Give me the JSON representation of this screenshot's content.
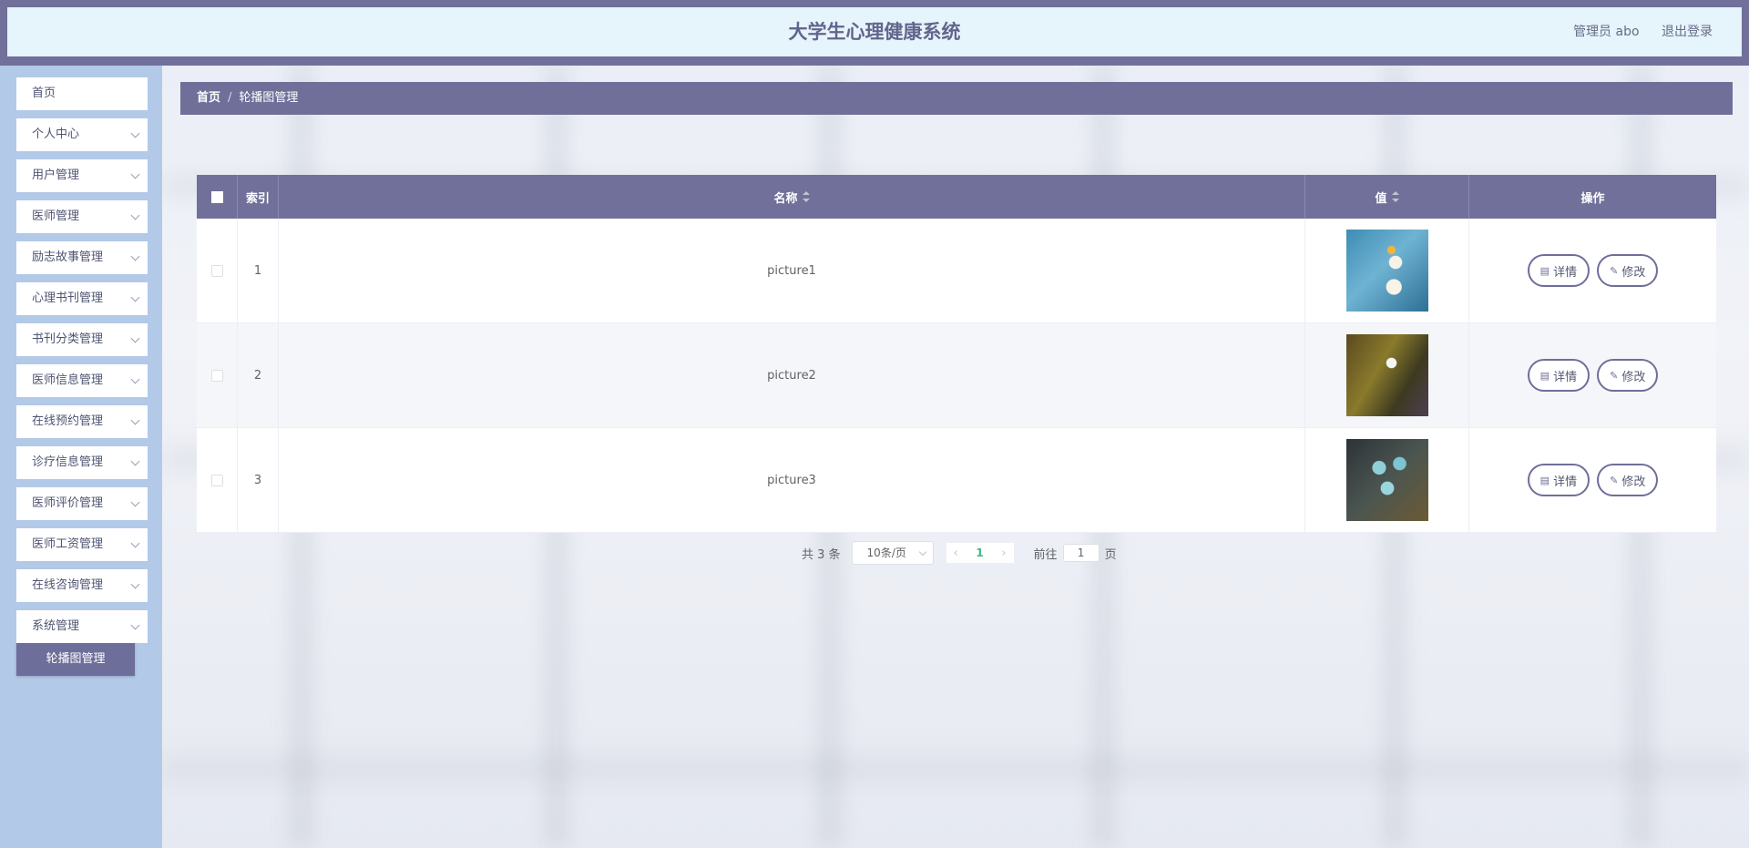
{
  "header": {
    "title": "大学生心理健康系统",
    "user_label": "管理员 abo",
    "logout_label": "退出登录"
  },
  "sidebar": {
    "items": [
      {
        "label": "首页",
        "has_arrow": false
      },
      {
        "label": "个人中心",
        "has_arrow": true
      },
      {
        "label": "用户管理",
        "has_arrow": true
      },
      {
        "label": "医师管理",
        "has_arrow": true
      },
      {
        "label": "励志故事管理",
        "has_arrow": true
      },
      {
        "label": "心理书刊管理",
        "has_arrow": true
      },
      {
        "label": "书刊分类管理",
        "has_arrow": true
      },
      {
        "label": "医师信息管理",
        "has_arrow": true
      },
      {
        "label": "在线预约管理",
        "has_arrow": true
      },
      {
        "label": "诊疗信息管理",
        "has_arrow": true
      },
      {
        "label": "医师评价管理",
        "has_arrow": true
      },
      {
        "label": "医师工资管理",
        "has_arrow": true
      },
      {
        "label": "在线咨询管理",
        "has_arrow": true
      },
      {
        "label": "系统管理",
        "has_arrow": true
      }
    ],
    "active_submenu": "轮播图管理"
  },
  "breadcrumb": {
    "home": "首页",
    "separator": "/",
    "current": "轮播图管理"
  },
  "table": {
    "columns": {
      "index": "索引",
      "name": "名称",
      "value": "值",
      "actions": "操作"
    },
    "rows": [
      {
        "index": "1",
        "name": "picture1",
        "image": "blue-daisy"
      },
      {
        "index": "2",
        "name": "picture2",
        "image": "golden-flower"
      },
      {
        "index": "3",
        "name": "picture3",
        "image": "teal-petals"
      }
    ],
    "detail_label": "详情",
    "edit_label": "修改"
  },
  "pagination": {
    "total_text": "共 3 条",
    "page_size": "10条/页",
    "current_page": "1",
    "goto_label": "前往",
    "goto_value": "1",
    "page_suffix": "页"
  },
  "colors": {
    "accent": "#70709a",
    "header_bg": "#e6f4fc",
    "sidebar_bg": "#b2c9e8",
    "active_page": "#3fb984"
  }
}
